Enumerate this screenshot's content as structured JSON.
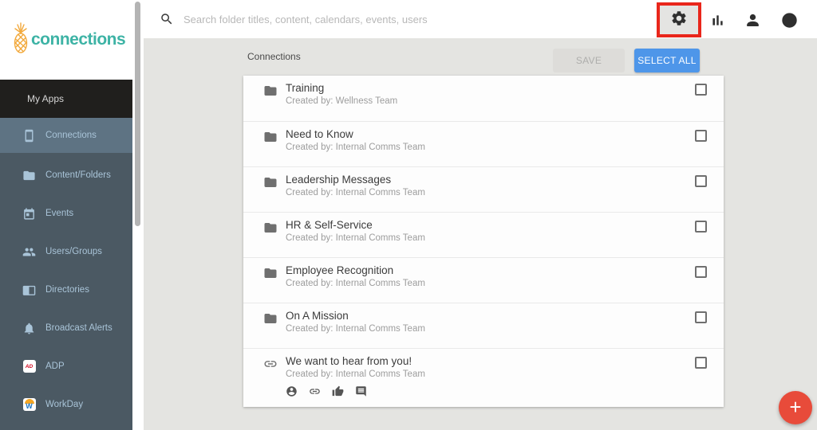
{
  "sidebar": {
    "logo_text": "connections",
    "my_apps_label": "My Apps",
    "selected_item": {
      "label": "Connections",
      "icon": "smartphone-icon"
    },
    "items": [
      {
        "label": "Content/Folders",
        "icon": "folder-icon"
      },
      {
        "label": "Events",
        "icon": "calendar-icon"
      },
      {
        "label": "Users/Groups",
        "icon": "people-icon"
      },
      {
        "label": "Directories",
        "icon": "directory-icon"
      },
      {
        "label": "Broadcast Alerts",
        "icon": "bell-icon"
      },
      {
        "label": "ADP",
        "icon": "adp-logo"
      },
      {
        "label": "WorkDay",
        "icon": "workday-logo"
      }
    ]
  },
  "topbar": {
    "search_placeholder": "Search folder titles, content, calendars, events, users",
    "icons": [
      "settings-gear-icon",
      "bar-chart-icon",
      "person-icon",
      "help-icon"
    ],
    "highlight_note": "settings gear outlined in red"
  },
  "content": {
    "header_label": "Connections",
    "save_button": "SAVE",
    "select_all_button": "SELECT ALL",
    "rows": [
      {
        "icon": "folder-icon",
        "title": "Training",
        "subtitle": "Created by: Wellness Team"
      },
      {
        "icon": "folder-icon",
        "title": "Need to Know",
        "subtitle": "Created by: Internal Comms Team"
      },
      {
        "icon": "folder-icon",
        "title": "Leadership Messages",
        "subtitle": "Created by: Internal Comms Team"
      },
      {
        "icon": "folder-icon",
        "title": "HR & Self-Service",
        "subtitle": "Created by: Internal Comms Team"
      },
      {
        "icon": "folder-icon",
        "title": "Employee Recognition",
        "subtitle": "Created by: Internal Comms Team"
      },
      {
        "icon": "folder-icon",
        "title": "On A Mission",
        "subtitle": "Created by: Internal Comms Team"
      },
      {
        "icon": "link-icon",
        "title": "We want to hear from you!",
        "subtitle": "Created by: Internal Comms Team",
        "actions": [
          "account-icon",
          "link-icon",
          "thumbs-up-icon",
          "comment-icon"
        ]
      }
    ]
  },
  "fab": {
    "label": "+"
  },
  "colors": {
    "sidebar_bg": "#4b5963",
    "sidebar_selected_bg": "#5e7383",
    "sidebar_text": "#a9c4d8",
    "myapps_bg": "#201f1d",
    "logo_teal": "#3db3a5",
    "pineapple_orange": "#f2a93c",
    "main_bg": "#e4e4e1",
    "card_bg": "#fdfdfd",
    "select_all_blue": "#4e96e9",
    "fab_red": "#e84b3a",
    "annotation_red": "#e9261b"
  }
}
